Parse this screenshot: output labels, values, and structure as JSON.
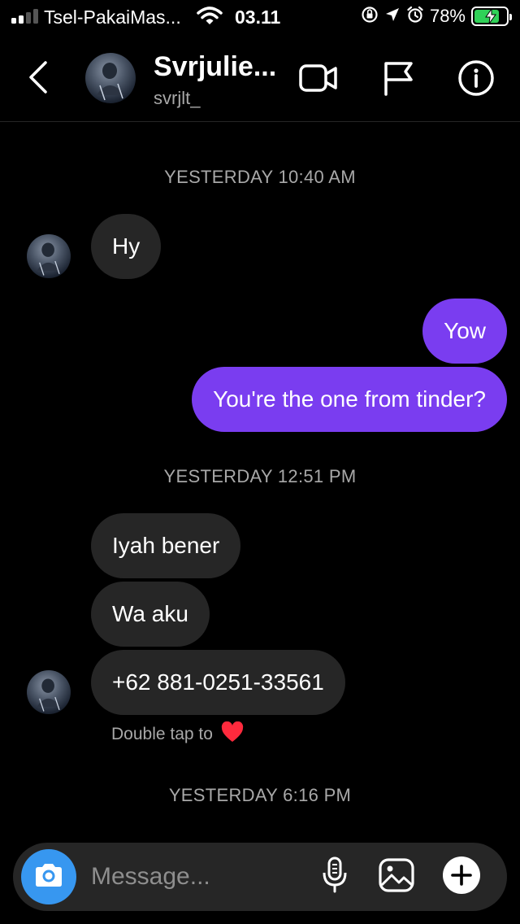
{
  "status_bar": {
    "carrier": "Tsel-PakaiMas...",
    "time": "03.11",
    "battery_percent": "78%",
    "battery_level": 0.78,
    "signal_bars": 2,
    "icons": [
      "signal-icon",
      "wifi-icon",
      "rotation-lock-icon",
      "location-icon",
      "alarm-icon",
      "battery-charging-icon"
    ]
  },
  "header": {
    "name": "Svrjulie...",
    "username": "svrjlt_",
    "icons": [
      "back-icon",
      "avatar",
      "video-call-icon",
      "report-flag-icon",
      "info-icon"
    ]
  },
  "conversation": {
    "timestamps": [
      "YESTERDAY 10:40 AM",
      "YESTERDAY 12:51 PM",
      "YESTERDAY 6:16 PM"
    ],
    "messages": [
      {
        "sender": "them",
        "text": "Hy"
      },
      {
        "sender": "me",
        "text": "Yow"
      },
      {
        "sender": "me",
        "text": "You're the one from tinder?"
      },
      {
        "sender": "them",
        "text": "Iyah bener"
      },
      {
        "sender": "them",
        "text": "Wa aku"
      },
      {
        "sender": "them",
        "text": "+62 881-0251-33561"
      }
    ],
    "like_hint": "Double tap to",
    "like_hint_icon": "heart-icon"
  },
  "composer": {
    "placeholder": "Message...",
    "icons": [
      "camera-icon",
      "microphone-icon",
      "gallery-icon",
      "add-icon"
    ]
  },
  "colors": {
    "background": "#000000",
    "received_bubble": "#262626",
    "sent_bubble": "#7a3df0",
    "camera_button": "#3797f0",
    "secondary_text": "#a8a8a8",
    "battery_charging": "#30d158",
    "heart": "#ff2a3d"
  }
}
